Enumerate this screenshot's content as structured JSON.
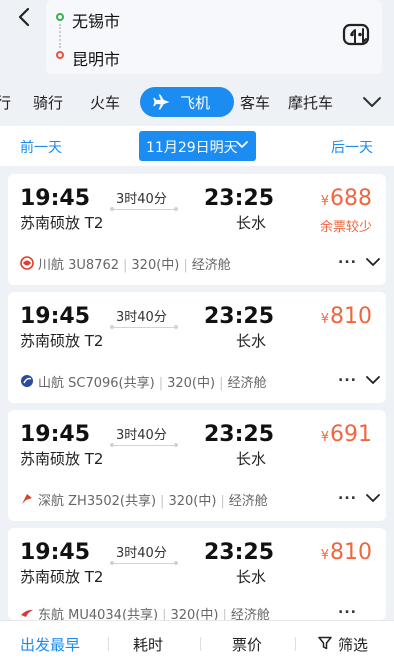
{
  "route": {
    "from": "无锡市",
    "to": "昆明市"
  },
  "header_icons": [
    "back-arrow-icon",
    "swap-icon",
    "chat-bubble-icon"
  ],
  "tabs": [
    {
      "label": "行",
      "active": false
    },
    {
      "label": "骑行",
      "active": false
    },
    {
      "label": "火车",
      "active": false
    },
    {
      "label": "飞机",
      "active": true
    },
    {
      "label": "客车",
      "active": false
    },
    {
      "label": "摩托车",
      "active": false
    }
  ],
  "date_bar": {
    "prev": "前一天",
    "current": "11月29日明天",
    "next": "后一天"
  },
  "flights": [
    {
      "dep_time": "19:45",
      "dep_airport": "苏南硕放 T2",
      "duration": "3时40分",
      "arr_time": "23:25",
      "arr_airport": "长水",
      "currency": "¥",
      "price": "688",
      "note": "余票较少",
      "airline": "川航 3U8762",
      "aircraft": "320(中)",
      "cabin": "经济舱",
      "more": "...",
      "logo_color": "#e0402a"
    },
    {
      "dep_time": "19:45",
      "dep_airport": "苏南硕放 T2",
      "duration": "3时40分",
      "arr_time": "23:25",
      "arr_airport": "长水",
      "currency": "¥",
      "price": "810",
      "note": "",
      "airline": "山航 SC7096(共享)",
      "aircraft": "320(中)",
      "cabin": "经济舱",
      "more": "...",
      "logo_color": "#2a4a9c"
    },
    {
      "dep_time": "19:45",
      "dep_airport": "苏南硕放 T2",
      "duration": "3时40分",
      "arr_time": "23:25",
      "arr_airport": "长水",
      "currency": "¥",
      "price": "691",
      "note": "",
      "airline": "深航 ZH3502(共享)",
      "aircraft": "320(中)",
      "cabin": "经济舱",
      "more": "...",
      "logo_color": "#e0402a"
    },
    {
      "dep_time": "19:45",
      "dep_airport": "苏南硕放 T2",
      "duration": "3时40分",
      "arr_time": "23:25",
      "arr_airport": "长水",
      "currency": "¥",
      "price": "810",
      "note": "",
      "airline": "东航 MU4034(共享)",
      "aircraft": "320(中)",
      "cabin": "经济舱",
      "more": "...",
      "logo_color": "#d63a3a"
    }
  ],
  "sort_bar": {
    "earliest": "出发最早",
    "duration": "耗时",
    "price": "票价",
    "filter": "筛选"
  },
  "colors": {
    "accent": "#1a8cf2",
    "price": "#f0663e"
  }
}
